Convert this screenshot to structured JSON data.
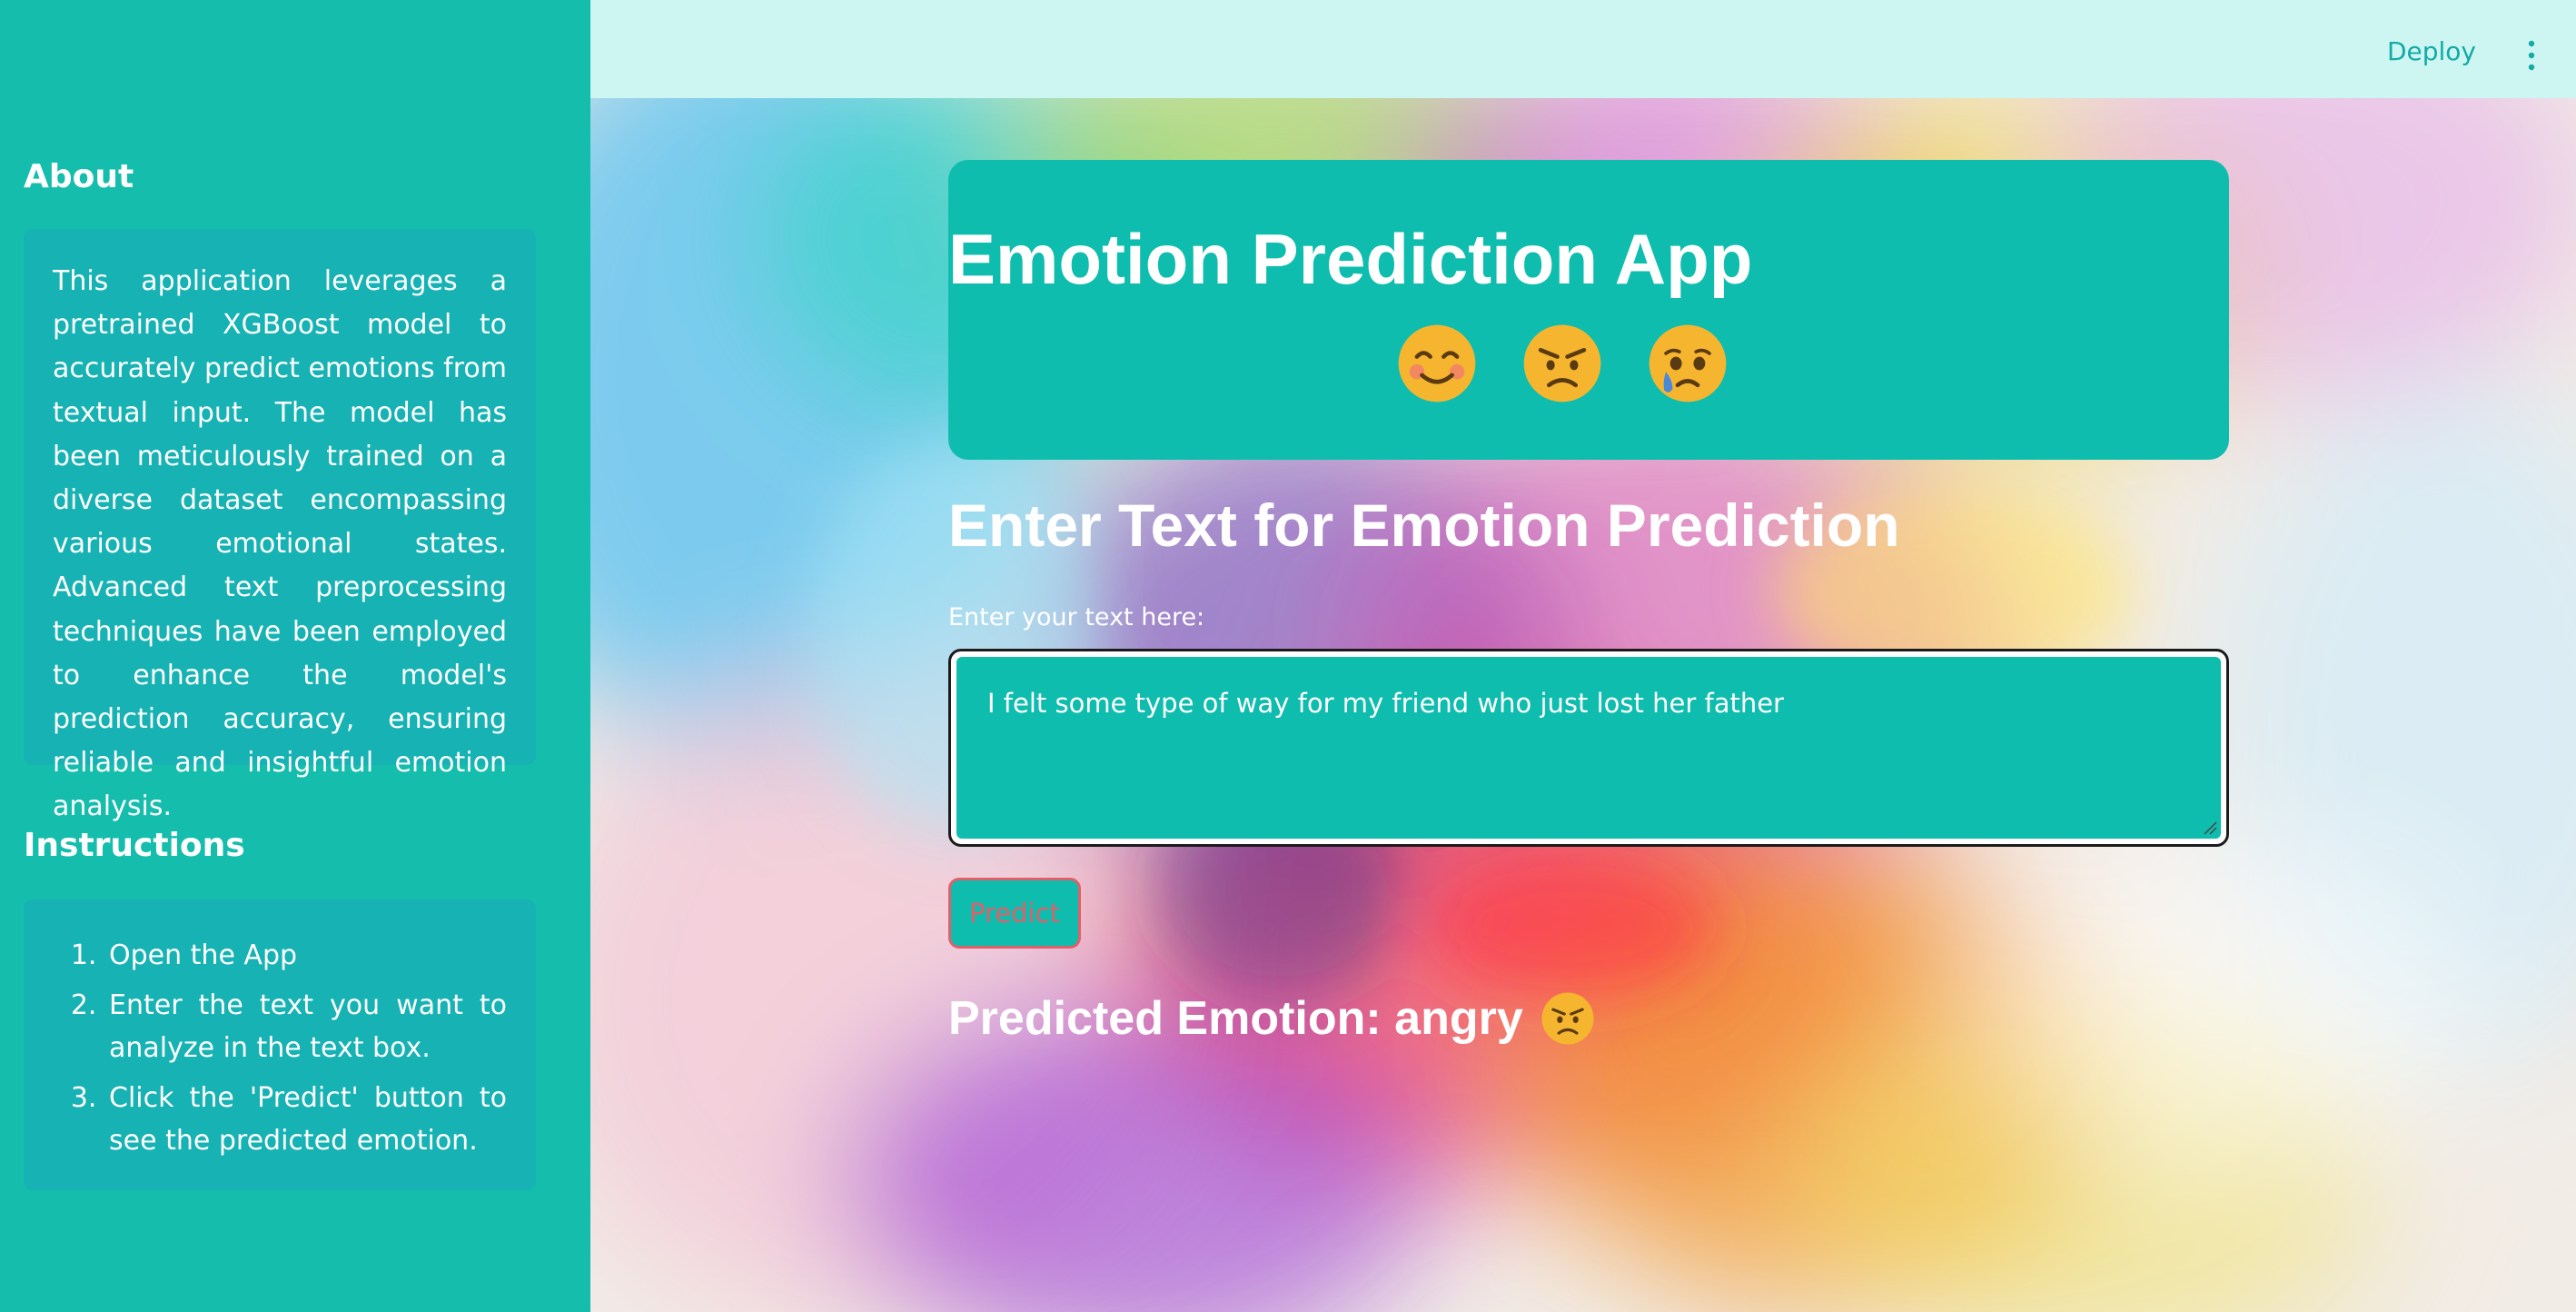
{
  "sidebar": {
    "about_heading": "About",
    "about_text": "This application leverages a pretrained XGBoost model to accurately predict emotions from textual input. The model has been meticulously trained on a diverse dataset encompassing various emotional states. Advanced text preprocessing techniques have been employed to enhance the model's prediction accuracy, ensuring reliable and insightful emotion analysis.",
    "instructions_heading": "Instructions",
    "instructions": [
      "Open the App",
      "Enter the text you want to analyze in the text box.",
      "Click the 'Predict' button to see the predicted emotion."
    ]
  },
  "topbar": {
    "deploy_label": "Deploy",
    "menu_icon": "vertical-ellipsis-icon"
  },
  "header": {
    "title": "Emotion Prediction App",
    "emojis": [
      "smiling-face-icon",
      "angry-face-icon",
      "crying-face-icon"
    ]
  },
  "form": {
    "section_title": "Enter Text for Emotion Prediction",
    "input_label": "Enter your text here:",
    "input_value": "I felt some type of way for my friend who just lost her father",
    "predict_label": "Predict"
  },
  "result": {
    "text": "Predicted Emotion: angry",
    "emoji": "angry-face-icon"
  },
  "colors": {
    "sidebar": "#14bdac",
    "sidebar_box": "#17b2b4",
    "accent": "#0fbdae",
    "topbar": "#cdf6f3",
    "deploy": "#14aaa5",
    "button_border": "#e0606a"
  }
}
